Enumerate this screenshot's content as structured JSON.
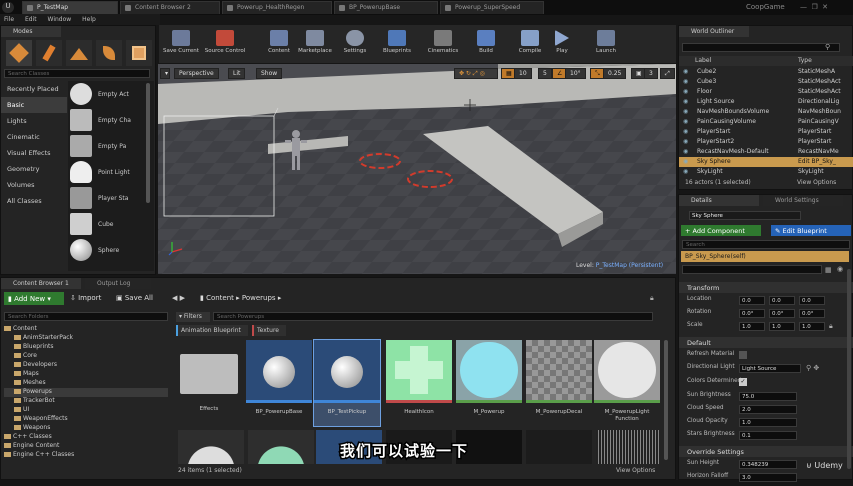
{
  "window": {
    "tabs": [
      "P_TestMap",
      "Content Browser 2",
      "Powerup_HealthRegen",
      "BP_PowerupBase",
      "Powerup_SuperSpeed"
    ],
    "project": "CoopGame",
    "menu": [
      "File",
      "Edit",
      "Window",
      "Help"
    ]
  },
  "modes": {
    "tab": "Modes",
    "search_placeholder": "Search Classes",
    "categories": [
      "Recently Placed",
      "Basic",
      "Lights",
      "Cinematic",
      "Visual Effects",
      "Geometry",
      "Volumes",
      "All Classes"
    ],
    "items": [
      "Empty Act",
      "Empty Cha",
      "Empty Pa",
      "Point Light",
      "Player Sta",
      "Cube",
      "Sphere"
    ]
  },
  "toolbar": [
    "Save Current",
    "Source Control",
    "Content",
    "Marketplace",
    "Settings",
    "Blueprints",
    "Cinematics",
    "Build",
    "Compile",
    "Play",
    "Launch"
  ],
  "viewport": {
    "perspective": "Perspective",
    "lit": "Lit",
    "show": "Show",
    "snap": "10",
    "grid": "5",
    "angle": "10°",
    "scale": "0.25",
    "cams": "3",
    "level_label": "Level:",
    "level_name": "P_TestMap (Persistent)"
  },
  "outliner": {
    "tab": "World Outliner",
    "col_label": "Label",
    "col_type": "Type",
    "rows": [
      {
        "label": "Cube2",
        "type": "StaticMeshA"
      },
      {
        "label": "Cube3",
        "type": "StaticMeshAct"
      },
      {
        "label": "Floor",
        "type": "StaticMeshAct"
      },
      {
        "label": "Light Source",
        "type": "DirectionalLig"
      },
      {
        "label": "NavMeshBoundsVolume",
        "type": "NavMeshBoun"
      },
      {
        "label": "PainCausingVolume",
        "type": "PainCausingV"
      },
      {
        "label": "PlayerStart",
        "type": "PlayerStart"
      },
      {
        "label": "PlayerStart2",
        "type": "PlayerStart"
      },
      {
        "label": "RecastNavMesh-Default",
        "type": "RecastNavMe"
      },
      {
        "label": "Sky Sphere",
        "type": "Edit BP_Sky_"
      },
      {
        "label": "SkyLight",
        "type": "SkyLight"
      }
    ],
    "count": "16 actors (1 selected)",
    "view_options": "View Options"
  },
  "details": {
    "tab": "Details",
    "tab2": "World Settings",
    "name": "Sky Sphere",
    "add_component": "+ Add Component",
    "edit_blueprint": "Edit Blueprint",
    "search": "Search",
    "component": "BP_Sky_Sphere(self)",
    "transform": "Transform",
    "location": "Location",
    "rotation": "Rotation",
    "scale": "Scale",
    "loc": [
      "0.0",
      "0.0",
      "0.0"
    ],
    "rot": [
      "0.0°",
      "0.0°",
      "0.0°"
    ],
    "scl": [
      "1.0",
      "1.0",
      "1.0"
    ],
    "default": "Default",
    "refresh_material": "Refresh Material",
    "dir_light": "Directional Light",
    "dir_light_val": "Light Source",
    "colors_determined": "Colors Determined",
    "sun_brightness": "Sun Brightness",
    "sun_val": "75.0",
    "cloud_speed": "Cloud Speed",
    "cloud_speed_val": "2.0",
    "cloud_opacity": "Cloud Opacity",
    "cloud_opacity_val": "1.0",
    "stars_brightness": "Stars Brightness",
    "stars_val": "0.1",
    "override": "Override Settings",
    "sun_height": "Sun Height",
    "sun_height_val": "0.348239",
    "horizon_falloff": "Horizon Falloff",
    "horizon_val": "3.0"
  },
  "content": {
    "tab": "Content Browser 1",
    "tab2": "Output Log",
    "add_new": "Add New",
    "import": "Import",
    "save_all": "Save All",
    "path_root": "Content",
    "path_sub": "Powerups",
    "search_folders": "Search Folders",
    "filters": "Filters",
    "search_assets": "Search Powerups",
    "filter_tags": [
      "Animation Blueprint",
      "Texture"
    ],
    "folders": [
      "Content",
      "AnimStarterPack",
      "Blueprints",
      "Core",
      "Developers",
      "Maps",
      "Meshes",
      "Powerups",
      "TrackerBot",
      "UI",
      "WeaponEffects",
      "Weapons",
      "C++ Classes",
      "Engine Content",
      "Engine C++ Classes"
    ],
    "assets": [
      "Effects",
      "BP_PowerupBase",
      "BP_TestPickup",
      "HealthIcon",
      "M_Powerup",
      "M_PowerupDecal",
      "M_PowerupLight Function"
    ],
    "count": "24 items (1 selected)",
    "view_options": "View Options"
  },
  "overlay": {
    "subtitle": "我们可以试验一下",
    "watermark": "Udemy"
  }
}
